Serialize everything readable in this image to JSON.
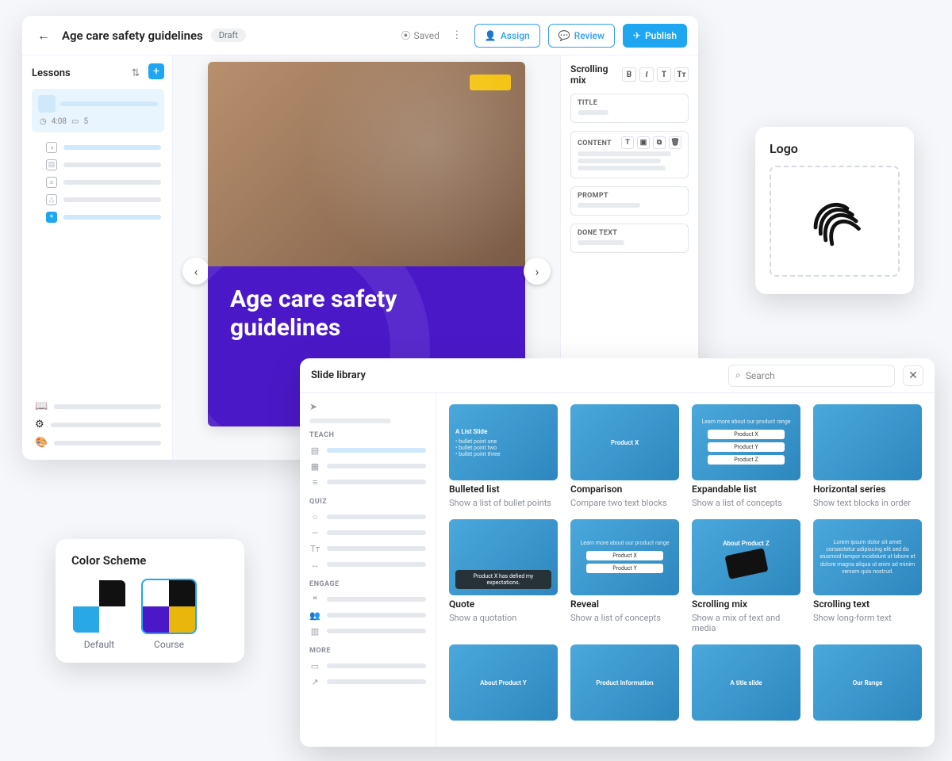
{
  "editor": {
    "title": "Age care safety guidelines",
    "status_badge": "Draft",
    "saved_label": "Saved",
    "assign_label": "Assign",
    "review_label": "Review",
    "publish_label": "Publish",
    "lessons_title": "Lessons",
    "lesson_meta_time": "4:08",
    "lesson_meta_count": "5",
    "slide_title": "Age care safety guidelines",
    "props_panel_title": "Scrolling mix",
    "fields": {
      "title": "TITLE",
      "content": "CONTENT",
      "prompt": "PROMPT",
      "done": "DONE TEXT"
    }
  },
  "logo_card": {
    "heading": "Logo"
  },
  "scheme_card": {
    "heading": "Color Scheme",
    "default_label": "Default",
    "course_label": "Course",
    "default_colors": [
      "#ffffff",
      "#111111",
      "#29a8e8",
      "#ffffff"
    ],
    "course_colors": [
      "#ffffff",
      "#111111",
      "#4b18c8",
      "#e9b60b"
    ]
  },
  "library": {
    "title": "Slide library",
    "search_placeholder": "Search",
    "nav_groups": {
      "teach": "TEACH",
      "quiz": "QUIZ",
      "engage": "ENGAGE",
      "more": "MORE"
    },
    "tiles": [
      {
        "name": "Bulleted list",
        "desc": "Show a list of bullet points",
        "preview_heading": "A List Slide"
      },
      {
        "name": "Comparison",
        "desc": "Compare two text blocks",
        "preview_heading": "Product X"
      },
      {
        "name": "Expandable list",
        "desc": "Show a list of concepts",
        "preview_heading": "Learn more about our product range",
        "rows": [
          "Product X",
          "Product Y",
          "Product Z"
        ]
      },
      {
        "name": "Horizontal series",
        "desc": "Show text blocks in order"
      },
      {
        "name": "Quote",
        "desc": "Show a quotation",
        "preview_heading": "Product X has defied my expectations."
      },
      {
        "name": "Reveal",
        "desc": "Show a list of concepts",
        "preview_heading": "Learn more about our product range",
        "rows": [
          "Product X",
          "Product Y"
        ]
      },
      {
        "name": "Scrolling mix",
        "desc": "Show a mix of text and media",
        "preview_heading": "About Product Z"
      },
      {
        "name": "Scrolling text",
        "desc": "Show long-form text"
      },
      {
        "name": "",
        "desc": "",
        "preview_heading": "About Product Y"
      },
      {
        "name": "",
        "desc": "",
        "preview_heading": "Product Information"
      },
      {
        "name": "",
        "desc": "",
        "preview_heading": "A title slide"
      },
      {
        "name": "",
        "desc": "",
        "preview_heading": "Our Range"
      }
    ]
  }
}
